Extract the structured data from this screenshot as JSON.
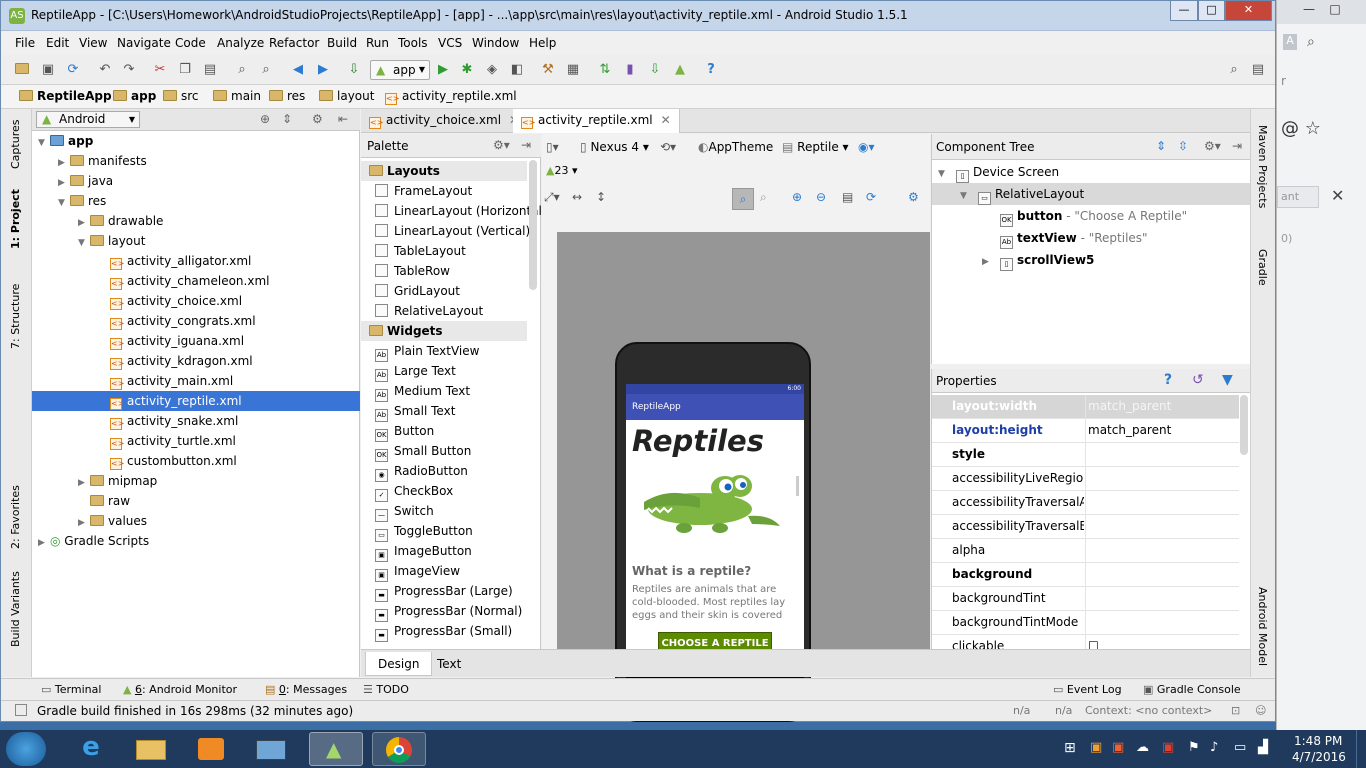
{
  "window": {
    "title": "ReptileApp - [C:\\Users\\Homework\\AndroidStudioProjects\\ReptileApp] - [app] - ...\\app\\src\\main\\res\\layout\\activity_reptile.xml - Android Studio 1.5.1",
    "app_icon": "AS",
    "min": "—",
    "max": "□",
    "close": "✕"
  },
  "menu": [
    "File",
    "Edit",
    "View",
    "Navigate",
    "Code",
    "Analyze",
    "Refactor",
    "Build",
    "Run",
    "Tools",
    "VCS",
    "Window",
    "Help"
  ],
  "toolbar": {
    "run_config": "app",
    "help": "?"
  },
  "breadcrumbs": [
    "ReptileApp",
    "app",
    "src",
    "main",
    "res",
    "layout",
    "activity_reptile.xml"
  ],
  "project": {
    "view_select": "Android",
    "tree": [
      {
        "label": "app",
        "depth": 0,
        "kind": "module",
        "expanded": true,
        "bold": true
      },
      {
        "label": "manifests",
        "depth": 1,
        "kind": "folder",
        "expanded": false
      },
      {
        "label": "java",
        "depth": 1,
        "kind": "folder",
        "expanded": false
      },
      {
        "label": "res",
        "depth": 1,
        "kind": "folder",
        "expanded": true
      },
      {
        "label": "drawable",
        "depth": 2,
        "kind": "folder",
        "expanded": false
      },
      {
        "label": "layout",
        "depth": 2,
        "kind": "folder",
        "expanded": true
      },
      {
        "label": "activity_alligator.xml",
        "depth": 3,
        "kind": "xml"
      },
      {
        "label": "activity_chameleon.xml",
        "depth": 3,
        "kind": "xml"
      },
      {
        "label": "activity_choice.xml",
        "depth": 3,
        "kind": "xml"
      },
      {
        "label": "activity_congrats.xml",
        "depth": 3,
        "kind": "xml"
      },
      {
        "label": "activity_iguana.xml",
        "depth": 3,
        "kind": "xml"
      },
      {
        "label": "activity_kdragon.xml",
        "depth": 3,
        "kind": "xml"
      },
      {
        "label": "activity_main.xml",
        "depth": 3,
        "kind": "xml"
      },
      {
        "label": "activity_reptile.xml",
        "depth": 3,
        "kind": "xml",
        "selected": true
      },
      {
        "label": "activity_snake.xml",
        "depth": 3,
        "kind": "xml"
      },
      {
        "label": "activity_turtle.xml",
        "depth": 3,
        "kind": "xml"
      },
      {
        "label": "custombutton.xml",
        "depth": 3,
        "kind": "xml"
      },
      {
        "label": "mipmap",
        "depth": 2,
        "kind": "folder",
        "expanded": false
      },
      {
        "label": "raw",
        "depth": 2,
        "kind": "folder",
        "leaf": true
      },
      {
        "label": "values",
        "depth": 2,
        "kind": "folder",
        "expanded": false
      },
      {
        "label": "Gradle Scripts",
        "depth": 0,
        "kind": "gradle",
        "expanded": false
      }
    ]
  },
  "left_strip": [
    "Captures",
    "1: Project",
    "7: Structure",
    "2: Favorites",
    "Build Variants"
  ],
  "right_strip": [
    "Maven Projects",
    "Gradle",
    "Android Model"
  ],
  "editor_tabs": [
    {
      "label": "activity_choice.xml",
      "active": false
    },
    {
      "label": "activity_reptile.xml",
      "active": true
    }
  ],
  "palette": {
    "title": "Palette",
    "rows": [
      {
        "label": "Layouts",
        "group": true
      },
      {
        "label": "FrameLayout"
      },
      {
        "label": "LinearLayout (Horizontal)"
      },
      {
        "label": "LinearLayout (Vertical)"
      },
      {
        "label": "TableLayout"
      },
      {
        "label": "TableRow"
      },
      {
        "label": "GridLayout"
      },
      {
        "label": "RelativeLayout"
      },
      {
        "label": "Widgets",
        "group": true
      },
      {
        "label": "Plain TextView",
        "icon": "Ab"
      },
      {
        "label": "Large Text",
        "icon": "Ab"
      },
      {
        "label": "Medium Text",
        "icon": "Ab"
      },
      {
        "label": "Small Text",
        "icon": "Ab"
      },
      {
        "label": "Button",
        "icon": "OK"
      },
      {
        "label": "Small Button",
        "icon": "OK"
      },
      {
        "label": "RadioButton",
        "icon": "◉"
      },
      {
        "label": "CheckBox",
        "icon": "✓"
      },
      {
        "label": "Switch",
        "icon": "—"
      },
      {
        "label": "ToggleButton",
        "icon": "▭"
      },
      {
        "label": "ImageButton",
        "icon": "▣"
      },
      {
        "label": "ImageView",
        "icon": "▣"
      },
      {
        "label": "ProgressBar (Large)",
        "icon": "▬"
      },
      {
        "label": "ProgressBar (Normal)",
        "icon": "▬"
      },
      {
        "label": "ProgressBar (Small)",
        "icon": "▬"
      }
    ]
  },
  "design_toolbar": {
    "device": "Nexus 4",
    "theme": "AppTheme",
    "activity": "Reptile",
    "api": "23"
  },
  "preview": {
    "status_time": "6:00",
    "app_title": "ReptileApp",
    "heading": "Reptiles",
    "subheading": "What is a reptile?",
    "body": "Reptiles are animals that are cold-blooded. Most reptiles lay eggs and their skin is covered",
    "button": "CHOOSE A REPTILE"
  },
  "component_tree": {
    "title": "Component Tree",
    "rows": [
      {
        "label": "Device Screen",
        "depth": 0,
        "icon": "▯"
      },
      {
        "label": "RelativeLayout",
        "depth": 1,
        "icon": "▭",
        "selected": true
      },
      {
        "label": "button",
        "detail": "- \"Choose A Reptile\"",
        "depth": 2,
        "icon": "OK"
      },
      {
        "label": "textView",
        "detail": "- \"Reptiles\"",
        "depth": 2,
        "icon": "Ab"
      },
      {
        "label": "scrollView5",
        "detail": "",
        "depth": 2,
        "icon": "▯"
      }
    ]
  },
  "properties": {
    "title": "Properties",
    "rows": [
      {
        "key": "layout:width",
        "value": "match_parent",
        "style": "hl"
      },
      {
        "key": "layout:height",
        "value": "match_parent",
        "style": "blue"
      },
      {
        "key": "style",
        "value": "",
        "style": "bold"
      },
      {
        "key": "accessibilityLiveRegion",
        "value": ""
      },
      {
        "key": "accessibilityTraversalAfte",
        "value": ""
      },
      {
        "key": "accessibilityTraversalBefc",
        "value": ""
      },
      {
        "key": "alpha",
        "value": ""
      },
      {
        "key": "background",
        "value": "",
        "style": "bold"
      },
      {
        "key": "backgroundTint",
        "value": ""
      },
      {
        "key": "backgroundTintMode",
        "value": ""
      },
      {
        "key": "clickable",
        "value": "☐"
      }
    ]
  },
  "design_tabs": [
    {
      "label": "Design",
      "active": true
    },
    {
      "label": "Text",
      "active": false
    }
  ],
  "tool_windows": {
    "left": [
      {
        "num": "",
        "label": "Terminal"
      },
      {
        "num": "6",
        "label": "Android Monitor"
      },
      {
        "num": "0",
        "label": "Messages"
      },
      {
        "num": "",
        "label": "TODO"
      }
    ],
    "right": [
      "Event Log",
      "Gradle Console"
    ]
  },
  "status": {
    "message": "Gradle build finished in 16s 298ms (32 minutes ago)",
    "na1": "n/a",
    "na2": "n/a",
    "context": "Context: <no context>"
  },
  "taskbar": {
    "time": "1:48 PM",
    "date": "4/7/2016"
  },
  "chrome_bg": {
    "search_letter": "A",
    "suggest": "ant",
    "close": "✕",
    "icons": "@  ☆",
    "paren": "0)",
    "r": "r"
  }
}
